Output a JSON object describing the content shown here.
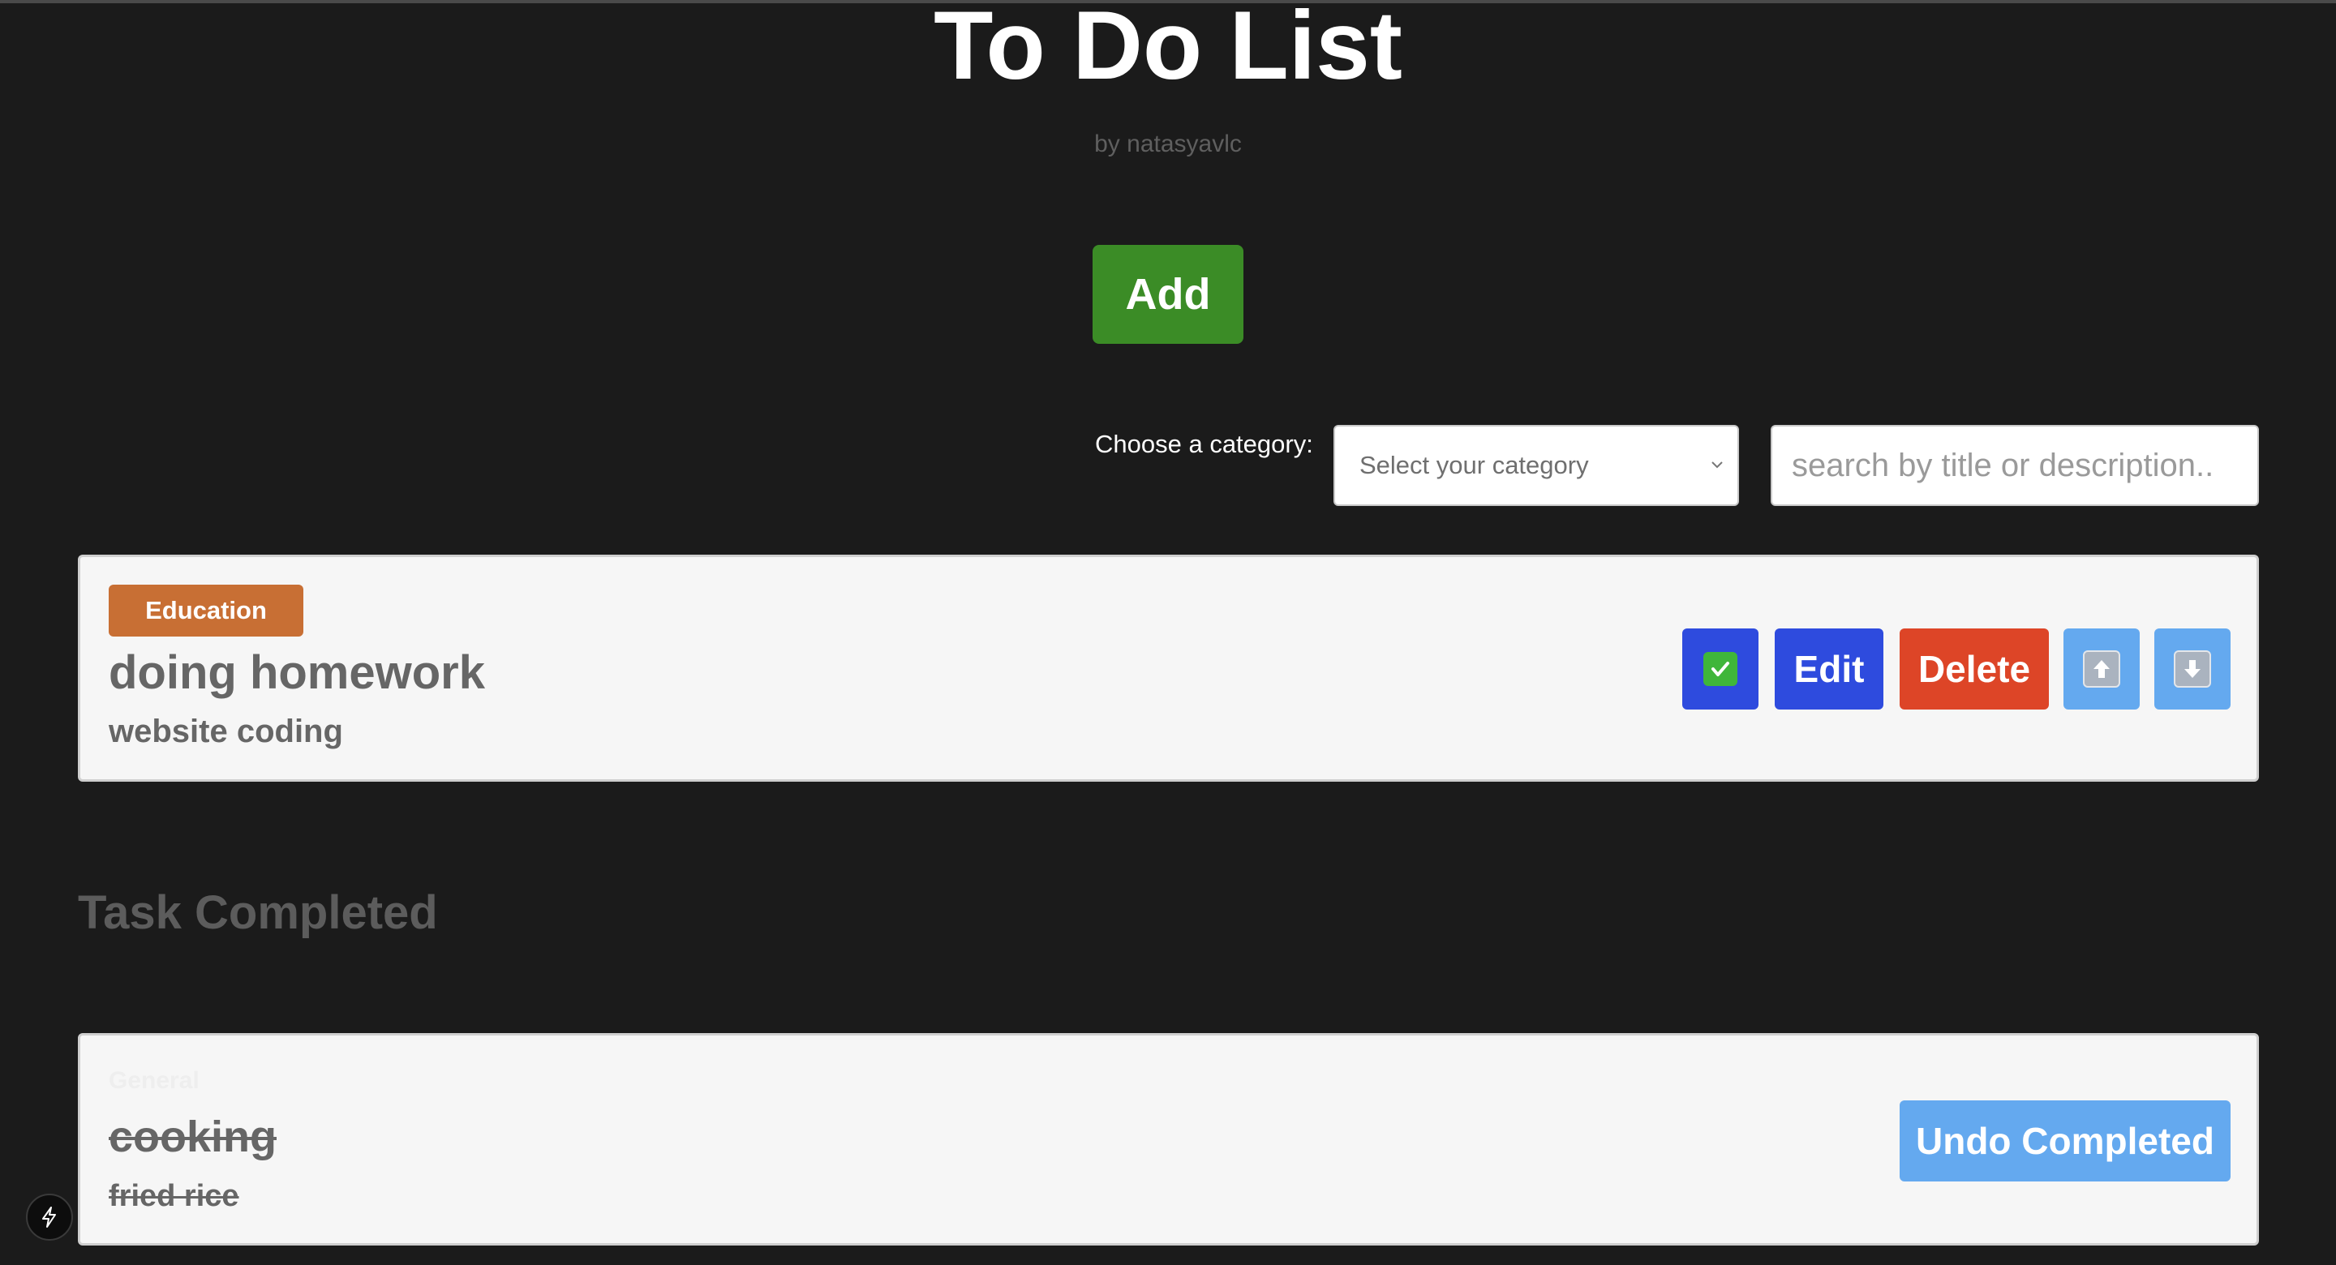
{
  "header": {
    "title": "To Do List",
    "byline": "by natasyavlc"
  },
  "toolbar": {
    "add_label": "Add"
  },
  "filters": {
    "category_label": "Choose a category:",
    "category_select_value": "Select your category",
    "search_placeholder": "search by title or description.."
  },
  "active_tasks": [
    {
      "category": "Education",
      "category_color": "#c86f34",
      "title": "doing homework",
      "description": "website coding",
      "complete_icon": "check-mark-icon",
      "edit_label": "Edit",
      "delete_label": "Delete",
      "move_up_icon": "arrow-up-icon",
      "move_down_icon": "arrow-down-icon"
    }
  ],
  "completed_section": {
    "heading": "Task Completed"
  },
  "completed_tasks": [
    {
      "category": "General",
      "title": "cooking",
      "description": "fried rice",
      "undo_label": "Undo Completed"
    }
  ],
  "colors": {
    "background": "#1b1b1b",
    "add_button": "#3b8c26",
    "primary_blue": "#2e4bde",
    "delete_red": "#dd4527",
    "light_blue": "#64a9ef"
  },
  "overlay": {
    "devtools_icon": "lightning-bolt-icon"
  }
}
